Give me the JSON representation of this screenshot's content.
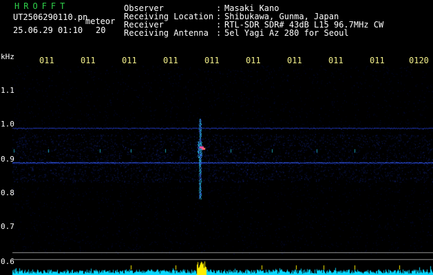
{
  "header": {
    "app_title": "HROFFT",
    "file_name": "UT2506290110.pn",
    "mode_label": "meteor",
    "date_time": "25.06.29 01:10",
    "count": "20",
    "info": [
      {
        "key": "Observer",
        "value": "Masaki Kano"
      },
      {
        "key": "Receiving Location",
        "value": "Shibukawa, Gunma, Japan"
      },
      {
        "key": "Receiver",
        "value": "RTL-SDR SDR# 43dB L15 96.7MHz CW"
      },
      {
        "key": "Receiving Antenna",
        "value": "5el Yagi Az 280 for Seoul"
      }
    ]
  },
  "plot": {
    "unit_label": "kHz",
    "time_ticks": [
      "011",
      "011",
      "011",
      "011",
      "011",
      "011",
      "011",
      "011",
      "011",
      "0120"
    ],
    "freq_labels": [
      "1.1",
      "1.0",
      "0.9",
      "0.8",
      "0.7",
      "0.6"
    ]
  },
  "colors": {
    "title_green": "#2fd24a",
    "tick_yellow": "#f2ef8a",
    "noise_blue": "#1d3bd8",
    "signal_cyan": "#28e6ff",
    "meteor_yellow": "#ffee00"
  }
}
